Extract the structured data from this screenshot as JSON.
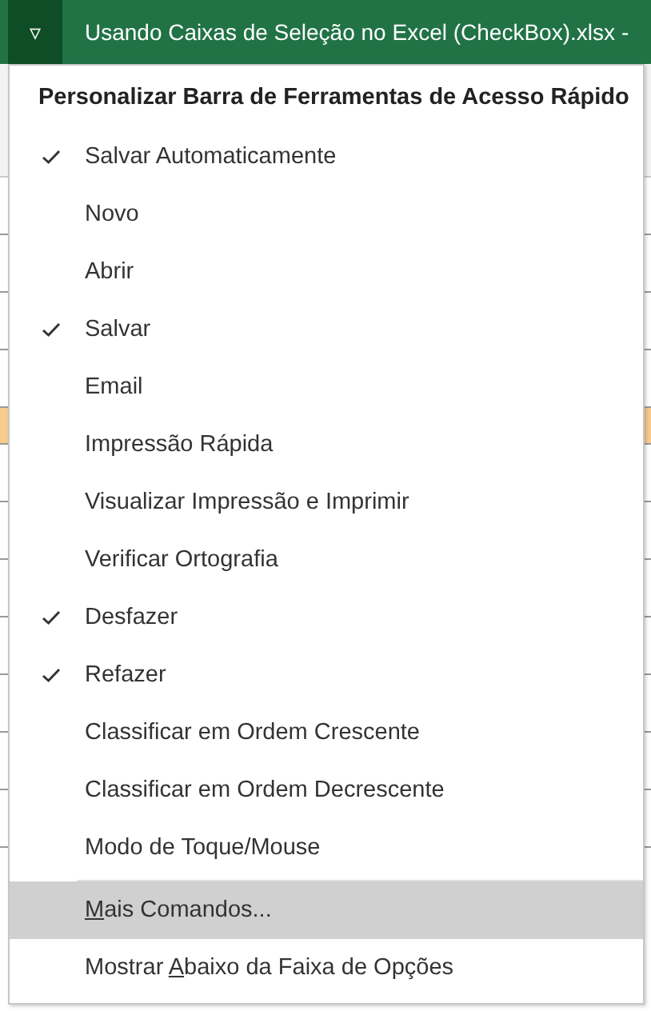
{
  "title_bar": {
    "menu_glyph": "▿",
    "title": "Usando Caixas de Seleção no Excel (CheckBox).xlsx",
    "title_tail": "-"
  },
  "menu": {
    "heading": "Personalizar Barra de Ferramentas de Acesso Rápido",
    "items": [
      {
        "kind": "toggle",
        "label": "Salvar Automaticamente",
        "checked": true
      },
      {
        "kind": "toggle",
        "label": "Novo",
        "checked": false
      },
      {
        "kind": "toggle",
        "label": "Abrir",
        "checked": false
      },
      {
        "kind": "toggle",
        "label": "Salvar",
        "checked": true
      },
      {
        "kind": "toggle",
        "label": "Email",
        "checked": false
      },
      {
        "kind": "toggle",
        "label": "Impressão Rápida",
        "checked": false
      },
      {
        "kind": "toggle",
        "label": "Visualizar Impressão e Imprimir",
        "checked": false
      },
      {
        "kind": "toggle",
        "label": "Verificar Ortografia",
        "checked": false
      },
      {
        "kind": "toggle",
        "label": "Desfazer",
        "checked": true
      },
      {
        "kind": "toggle",
        "label": "Refazer",
        "checked": true
      },
      {
        "kind": "toggle",
        "label": "Classificar em Ordem Crescente",
        "checked": false
      },
      {
        "kind": "toggle",
        "label": "Classificar em Ordem Decrescente",
        "checked": false
      },
      {
        "kind": "toggle",
        "label": "Modo de Toque/Mouse",
        "checked": false
      },
      {
        "kind": "separator"
      },
      {
        "kind": "command",
        "key": "M",
        "after": "ais Comandos...",
        "selected": true
      },
      {
        "kind": "command",
        "before": "Mostrar ",
        "key": "A",
        "after": "baixo da Faixa de Opções",
        "selected": false
      }
    ]
  }
}
